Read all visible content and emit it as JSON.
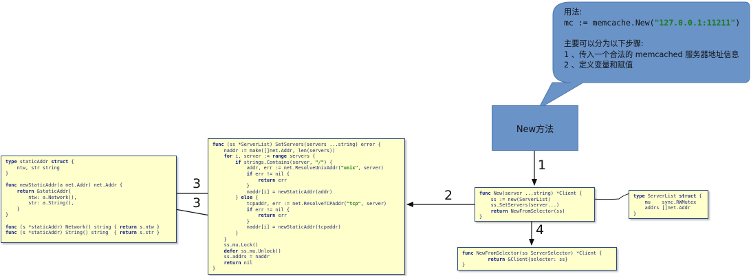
{
  "callout": {
    "usage_label": "用法:",
    "usage_code_prefix": "mc := memcache.New(",
    "usage_code_string": "\"127.0.0.1:11211\"",
    "usage_code_suffix": ")",
    "steps_title": "主要可以分为以下步骤:",
    "step1": "1 、传入一个合法的 memcached 服务器地址信息",
    "step2": "2 、定义变量和赋值"
  },
  "new_method": {
    "label": "New方法"
  },
  "arrow_labels": {
    "a1": "1",
    "a2": "2",
    "a3_upper": "3",
    "a3_lower": "3",
    "a4": "4"
  },
  "colors": {
    "callout_fill": "#6a93c8",
    "code_bg": "#ffffcc",
    "string_green": "#1a7a1a"
  },
  "code": {
    "static_addr": [
      "type staticAddr struct {",
      "    ntw, str string",
      "}",
      "",
      "func newStaticAddr(a net.Addr) net.Addr {",
      "    return &staticAddr{",
      "        ntw: a.Network(),",
      "        str: a.String(),",
      "    }",
      "}",
      "",
      "func (s *staticAddr) Network() string { return s.ntw }",
      "func (s *staticAddr) String() string  { return s.str }"
    ],
    "set_servers": [
      "func (ss *ServerList) SetServers(servers ...string) error {",
      "    naddr := make([]net.Addr, len(servers))",
      "    for i, server := range servers {",
      "        if strings.Contains(server, \"/\") {",
      "            addr, err := net.ResolveUnixAddr(\"unix\", server)",
      "            if err != nil {",
      "                return err",
      "            }",
      "            naddr[i] = newStaticAddr(addr)",
      "        } else {",
      "            tcpaddr, err := net.ResolveTCPAddr(\"tcp\", server)",
      "            if err != nil {",
      "                return err",
      "            }",
      "            naddr[i] = newStaticAddr(tcpaddr)",
      "        }",
      "    }",
      "    ss.mu.Lock()",
      "    defer ss.mu.Unlock()",
      "    ss.addrs = naddr",
      "    return nil",
      "}"
    ],
    "new_func": [
      "func New(server ...string) *Client {",
      "    ss := new(ServerList)",
      "    ss.SetServers(server...)",
      "    return NewFromSelector(ss)",
      "}"
    ],
    "from_selector": [
      "func NewFromSelector(ss ServerSelector) *Client {",
      "         return &Client{selector: ss}",
      "}"
    ],
    "server_list": [
      "type ServerList struct {",
      "    mu    sync.RWMutex",
      "    addrs []net.Addr",
      "}"
    ]
  }
}
